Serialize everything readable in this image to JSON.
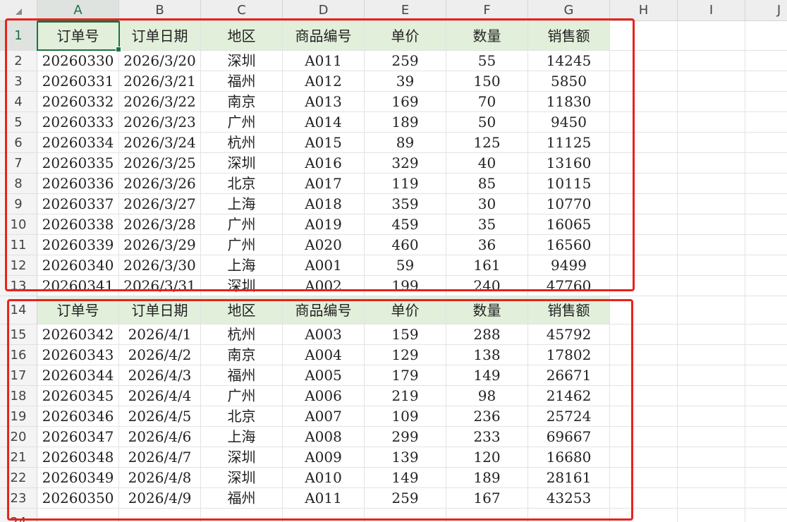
{
  "columns": [
    "A",
    "B",
    "C",
    "D",
    "E",
    "F",
    "G",
    "H",
    "I",
    "J"
  ],
  "active_column": "A",
  "active_row": "1",
  "rows": [
    {
      "num": "1",
      "kind": "header",
      "cells": [
        "订单号",
        "订单日期",
        "地区",
        "商品编号",
        "单价",
        "数量",
        "销售额"
      ]
    },
    {
      "num": "2",
      "kind": "data",
      "cells": [
        "20260330",
        "2026/3/20",
        "深圳",
        "A011",
        "259",
        "55",
        "14245"
      ]
    },
    {
      "num": "3",
      "kind": "data",
      "cells": [
        "20260331",
        "2026/3/21",
        "福州",
        "A012",
        "39",
        "150",
        "5850"
      ]
    },
    {
      "num": "4",
      "kind": "data",
      "cells": [
        "20260332",
        "2026/3/22",
        "南京",
        "A013",
        "169",
        "70",
        "11830"
      ]
    },
    {
      "num": "5",
      "kind": "data",
      "cells": [
        "20260333",
        "2026/3/23",
        "广州",
        "A014",
        "189",
        "50",
        "9450"
      ]
    },
    {
      "num": "6",
      "kind": "data",
      "cells": [
        "20260334",
        "2026/3/24",
        "杭州",
        "A015",
        "89",
        "125",
        "11125"
      ]
    },
    {
      "num": "7",
      "kind": "data",
      "cells": [
        "20260335",
        "2026/3/25",
        "深圳",
        "A016",
        "329",
        "40",
        "13160"
      ]
    },
    {
      "num": "8",
      "kind": "data",
      "cells": [
        "20260336",
        "2026/3/26",
        "北京",
        "A017",
        "119",
        "85",
        "10115"
      ]
    },
    {
      "num": "9",
      "kind": "data",
      "cells": [
        "20260337",
        "2026/3/27",
        "上海",
        "A018",
        "359",
        "30",
        "10770"
      ]
    },
    {
      "num": "10",
      "kind": "data",
      "cells": [
        "20260338",
        "2026/3/28",
        "广州",
        "A019",
        "459",
        "35",
        "16065"
      ]
    },
    {
      "num": "11",
      "kind": "data",
      "cells": [
        "20260339",
        "2026/3/29",
        "广州",
        "A020",
        "460",
        "36",
        "16560"
      ]
    },
    {
      "num": "12",
      "kind": "data",
      "cells": [
        "20260340",
        "2026/3/30",
        "上海",
        "A001",
        "59",
        "161",
        "9499"
      ]
    },
    {
      "num": "13",
      "kind": "data",
      "cells": [
        "20260341",
        "2026/3/31",
        "深圳",
        "A002",
        "199",
        "240",
        "47760"
      ]
    },
    {
      "num": "14",
      "kind": "header",
      "cells": [
        "订单号",
        "订单日期",
        "地区",
        "商品编号",
        "单价",
        "数量",
        "销售额"
      ]
    },
    {
      "num": "15",
      "kind": "data",
      "cells": [
        "20260342",
        "2026/4/1",
        "杭州",
        "A003",
        "159",
        "288",
        "45792"
      ]
    },
    {
      "num": "16",
      "kind": "data",
      "cells": [
        "20260343",
        "2026/4/2",
        "南京",
        "A004",
        "129",
        "138",
        "17802"
      ]
    },
    {
      "num": "17",
      "kind": "data",
      "cells": [
        "20260344",
        "2026/4/3",
        "福州",
        "A005",
        "179",
        "149",
        "26671"
      ]
    },
    {
      "num": "18",
      "kind": "data",
      "cells": [
        "20260345",
        "2026/4/4",
        "广州",
        "A006",
        "219",
        "98",
        "21462"
      ]
    },
    {
      "num": "19",
      "kind": "data",
      "cells": [
        "20260346",
        "2026/4/5",
        "北京",
        "A007",
        "109",
        "236",
        "25724"
      ]
    },
    {
      "num": "20",
      "kind": "data",
      "cells": [
        "20260347",
        "2026/4/6",
        "上海",
        "A008",
        "299",
        "233",
        "69667"
      ]
    },
    {
      "num": "21",
      "kind": "data",
      "cells": [
        "20260348",
        "2026/4/7",
        "深圳",
        "A009",
        "139",
        "120",
        "16680"
      ]
    },
    {
      "num": "22",
      "kind": "data",
      "cells": [
        "20260349",
        "2026/4/8",
        "深圳",
        "A010",
        "149",
        "189",
        "28161"
      ]
    },
    {
      "num": "23",
      "kind": "data",
      "cells": [
        "20260350",
        "2026/4/9",
        "福州",
        "A011",
        "259",
        "167",
        "43253"
      ]
    },
    {
      "num": "24",
      "kind": "empty",
      "cells": []
    }
  ],
  "colors": {
    "header_fill": "#e2efda",
    "selection": "#1e7145",
    "highlight_frame": "#e8231b"
  }
}
